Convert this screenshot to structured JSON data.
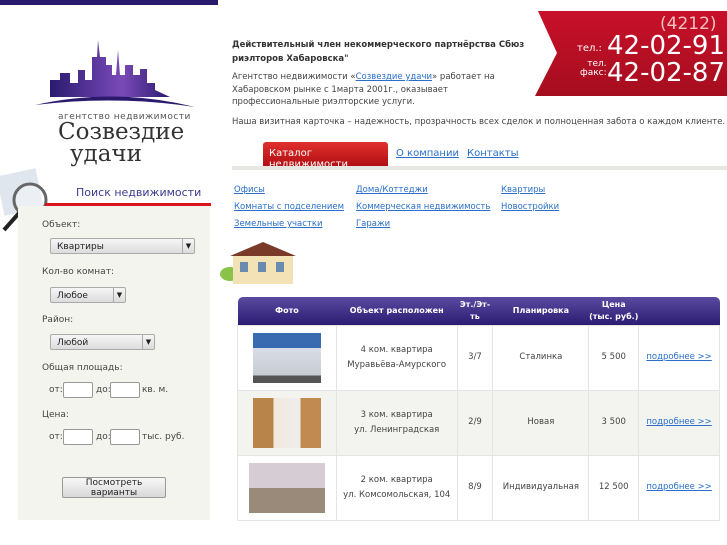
{
  "logo": {
    "line1": "агентство недвижимости",
    "line2": "Созвездие",
    "line3": "удачи"
  },
  "search": {
    "title": "Поиск недвижимости",
    "object_label": "Объект:",
    "object_value": "Квартиры",
    "rooms_label": "Кол-во комнат:",
    "rooms_value": "Любое",
    "district_label": "Район:",
    "district_value": "Любой",
    "area_label": "Общая площадь:",
    "from": "от:",
    "to": "до:",
    "area_unit": "кв. м.",
    "price_label": "Цена:",
    "price_unit": "тыс. руб.",
    "submit": "Посмотреть варианты"
  },
  "intro": {
    "bold": "Действительный член некоммерческого партнёрства  Сбюз риэлторов Хабаровска\"",
    "p_before": "Агентство недвижимости «",
    "p_link": "Созвездие удачи",
    "p_after": "» работает на Хабаровском рынке с  1марта  2001г., оказывает профессиональные риэлторские услуги.",
    "p2": "Наша визитная карточка – надежность, прозрачность всех сделок и полноценная забота о каждом клиенте."
  },
  "phone": {
    "code": "(4212)",
    "tel_label": "тел.:",
    "tel": "42-02-91",
    "fax_label1": "тел.",
    "fax_label2": "факс:",
    "fax": "42-02-87"
  },
  "nav": {
    "tabs": [
      "Каталог недвижимости",
      "О компании",
      "Контакты"
    ]
  },
  "categories": [
    "Офисы",
    "Комнаты с подселением",
    "Земельные участки",
    "Дома/Коттеджи",
    "Коммерческая недвижимость",
    "Гаражи",
    "Квартиры",
    "Новостройки"
  ],
  "table": {
    "headers": [
      "Фото",
      "Объект расположен",
      "Эт./Эт-ть",
      "Планировка",
      "Цена (тыс. руб.)",
      ""
    ],
    "rows": [
      {
        "obj1": "4 ком. квартира",
        "obj2": "Муравьёва-Амурского",
        "floor": "3/7",
        "plan": "Сталинка",
        "price": "5 500",
        "link": "подробнее >>"
      },
      {
        "obj1": "3 ком. квартира",
        "obj2": "ул. Ленинградская",
        "floor": "2/9",
        "plan": "Новая",
        "price": "3 500",
        "link": "подробнее >>"
      },
      {
        "obj1": "2 ком. квартира",
        "obj2": "ул. Комсомольская, 104",
        "floor": "8/9",
        "plan": "Индивидуальная",
        "price": "12 500",
        "link": "подробнее >>"
      }
    ]
  },
  "colors": {
    "brand_purple": "#2a1a6e",
    "accent_red": "#d9141e",
    "link": "#2a6fc9"
  }
}
